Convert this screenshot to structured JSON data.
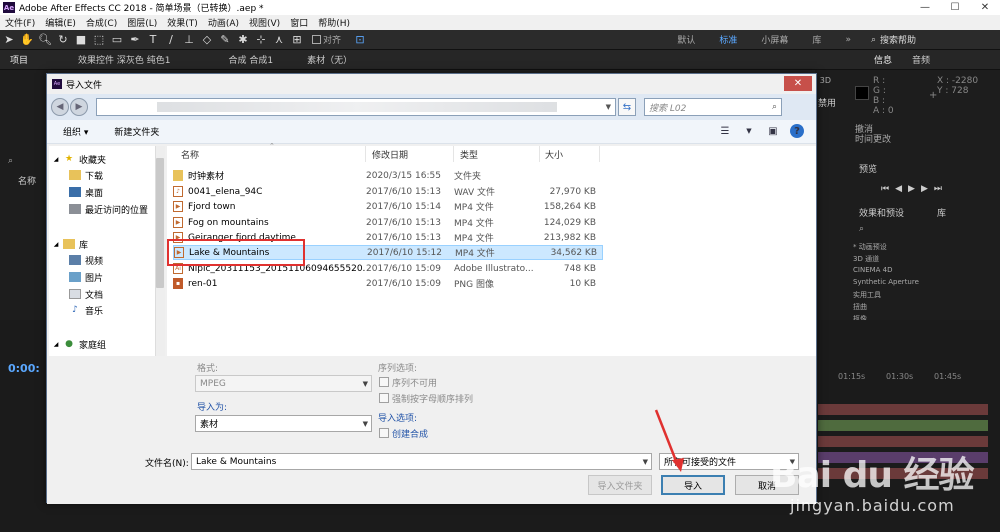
{
  "app": {
    "title": "Adobe After Effects CC 2018 - 简单场景（已转换）.aep *",
    "logo": "Ae"
  },
  "menu": [
    "文件(F)",
    "编辑(E)",
    "合成(C)",
    "图层(L)",
    "效果(T)",
    "动画(A)",
    "视图(V)",
    "窗口",
    "帮助(H)"
  ],
  "toolbar": {
    "snap_label": "对齐",
    "workspaces": [
      "默认",
      "标准",
      "小屏幕",
      "库"
    ],
    "active_workspace": "标准",
    "search_help": "搜索帮助"
  },
  "panels": {
    "project_tab": "项目",
    "effects_controls_tab": "效果控件 深灰色 纯色1",
    "composition_tab": "合成 合成1",
    "footage_tab": "素材（无）",
    "info_tab": "信息",
    "audio_tab": "音频",
    "info": {
      "r": "R :",
      "g": "G :",
      "b": "B :",
      "a": "A : 0",
      "x": "X : -2280",
      "y": "Y : 728"
    },
    "undo": "撤消",
    "history": "时间更改",
    "preview_tab": "预览",
    "effects_presets_tab": "效果和预设",
    "library_tab": "库",
    "effects_list": [
      "* 动画预设",
      "3D 通道",
      "CINEMA 4D",
      "Synthetic Aperture",
      "实用工具",
      "扭曲",
      "抠像"
    ],
    "project_name_col": "名称",
    "disabled_text": "禁用",
    "timeline_time": "0:00:",
    "ruler": [
      "01:15s",
      "01:30s",
      "01:45s"
    ],
    "render_label": "染器: 经典 3D"
  },
  "dialog": {
    "title": "导入文件",
    "close": "✕",
    "address_placeholder": "",
    "search_placeholder": "搜索 L02",
    "organize": "组织 ▾",
    "new_folder": "新建文件夹",
    "nav": {
      "favorites": "收藏夹",
      "downloads": "下载",
      "desktop": "桌面",
      "recent": "最近访问的位置",
      "libraries": "库",
      "videos": "视频",
      "pictures": "图片",
      "documents": "文档",
      "music": "音乐",
      "homegroup": "家庭组"
    },
    "columns": {
      "name": "名称",
      "date": "修改日期",
      "type": "类型",
      "size": "大小"
    },
    "files": [
      {
        "name": "时钟素材",
        "date": "2020/3/15 16:55",
        "type": "文件夹",
        "size": "",
        "icon": "folder-icon"
      },
      {
        "name": "0041_elena_94C",
        "date": "2017/6/10 15:13",
        "type": "WAV 文件",
        "size": "27,970 KB",
        "icon": "audio-file-icon"
      },
      {
        "name": "Fjord town",
        "date": "2017/6/10 15:14",
        "type": "MP4 文件",
        "size": "158,264 KB",
        "icon": "video-file-icon"
      },
      {
        "name": "Fog on mountains",
        "date": "2017/6/10 15:13",
        "type": "MP4 文件",
        "size": "124,029 KB",
        "icon": "video-file-icon"
      },
      {
        "name": "Geiranger fjord daytime",
        "date": "2017/6/10 15:13",
        "type": "MP4 文件",
        "size": "213,982 KB",
        "icon": "video-file-icon"
      },
      {
        "name": "Lake & Mountains",
        "date": "2017/6/10 15:12",
        "type": "MP4 文件",
        "size": "34,562 KB",
        "icon": "video-file-icon",
        "selected": true
      },
      {
        "name": "Nipic_20311153_20151106094655520...",
        "date": "2017/6/10 15:09",
        "type": "Adobe Illustrato...",
        "size": "748 KB",
        "icon": "ai-file-icon"
      },
      {
        "name": "ren-01",
        "date": "2017/6/10 15:09",
        "type": "PNG 图像",
        "size": "10 KB",
        "icon": "image-file-icon"
      }
    ],
    "format_label": "格式:",
    "format_value": "MPEG",
    "import_as_label": "导入为:",
    "import_as_value": "素材",
    "sequence_options_label": "序列选项:",
    "sequence_unavailable": "序列不可用",
    "force_alpha_order": "强制按字母顺序排列",
    "import_options_label": "导入选项:",
    "create_composition": "创建合成",
    "filename_label": "文件名(N):",
    "filename_value": "Lake & Mountains",
    "filetype_value": "所有可接受的文件",
    "import_folder_button": "导入文件夹",
    "import_button": "导入",
    "cancel_button": "取消"
  },
  "watermark": {
    "brand": "Bai du 经验",
    "url": "jingyan.baidu.com"
  },
  "colors": {
    "accent": "#5ba8ff",
    "selection": "#cce8ff",
    "highlight_box": "#e0312f",
    "close_red": "#c7504a"
  }
}
